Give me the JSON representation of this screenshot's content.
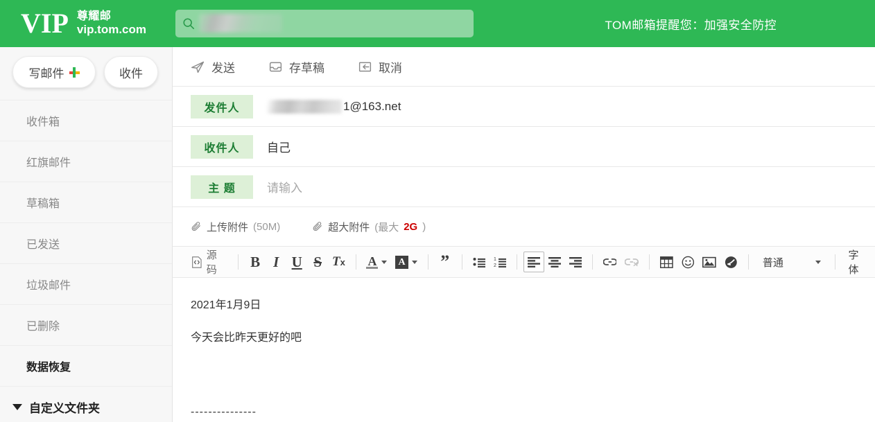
{
  "header": {
    "brand_vip": "VIP",
    "brand_cn": "尊耀邮",
    "brand_url": "vip.tom.com",
    "search_icon": "search-icon",
    "search_value": "",
    "search_placeholder": "",
    "notice": "TOM邮箱提醒您：加强安全防控",
    "bg_color": "#2eb855"
  },
  "sidebar": {
    "compose_label": "写邮件",
    "compose_icon": "plus-icon",
    "receive_label": "收件",
    "folders": [
      {
        "label": "收件箱",
        "strong": false
      },
      {
        "label": "红旗邮件",
        "strong": false
      },
      {
        "label": "草稿箱",
        "strong": false
      },
      {
        "label": "已发送",
        "strong": false
      },
      {
        "label": "垃圾邮件",
        "strong": false
      },
      {
        "label": "已删除",
        "strong": false
      },
      {
        "label": "数据恢复",
        "strong": true
      }
    ],
    "custom_folder_label": "自定义文件夹",
    "custom_folder_icon": "caret-down-icon"
  },
  "compose": {
    "actions": [
      {
        "label": "发送",
        "icon": "send-icon"
      },
      {
        "label": "存草稿",
        "icon": "save-draft-icon"
      },
      {
        "label": "取消",
        "icon": "cancel-icon"
      }
    ],
    "fields": [
      {
        "label": "发件人",
        "value": "1@163.net",
        "redacted": true,
        "placeholder": ""
      },
      {
        "label": "收件人",
        "value": "自己",
        "redacted": false,
        "placeholder": ""
      },
      {
        "label": "主 题",
        "value": "",
        "redacted": false,
        "placeholder": "请输入"
      }
    ],
    "attachments": [
      {
        "icon": "paperclip-icon",
        "label": "上传附件",
        "detail": "(50M)",
        "hot": ""
      },
      {
        "icon": "paperclip-icon",
        "label": "超大附件",
        "detail_prefix": "(最大 ",
        "hot": "2G",
        "detail_suffix": ")"
      }
    ]
  },
  "editor": {
    "source_label": "源码",
    "buttons": [
      {
        "name": "bold",
        "label": "B"
      },
      {
        "name": "italic",
        "label": "I"
      },
      {
        "name": "underline",
        "label": "U"
      },
      {
        "name": "strikethrough",
        "label": "S"
      },
      {
        "name": "remove-format",
        "label": "Tx"
      },
      {
        "name": "text-color",
        "label": "A"
      },
      {
        "name": "background-color",
        "label": "A"
      },
      {
        "name": "blockquote",
        "label": "”"
      },
      {
        "name": "bullet-list",
        "label": ""
      },
      {
        "name": "numbered-list",
        "label": ""
      },
      {
        "name": "align-left",
        "label": ""
      },
      {
        "name": "align-center",
        "label": ""
      },
      {
        "name": "align-right",
        "label": ""
      },
      {
        "name": "link",
        "label": ""
      },
      {
        "name": "unlink",
        "label": ""
      },
      {
        "name": "table",
        "label": ""
      },
      {
        "name": "emoji",
        "label": ""
      },
      {
        "name": "image",
        "label": ""
      },
      {
        "name": "signature",
        "label": ""
      }
    ],
    "style_select_value": "普通",
    "font_label": "字体",
    "active_button": "align-left"
  },
  "message_body": {
    "line1": "2021年1月9日",
    "line2": "今天会比昨天更好的吧",
    "signature_divider": "---------------"
  }
}
